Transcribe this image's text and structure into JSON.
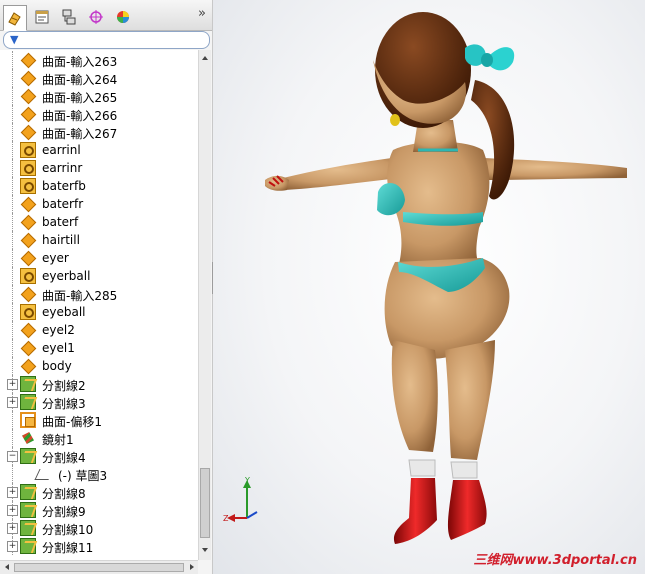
{
  "tabs": [
    {
      "name": "feature-manager",
      "icon": "feature-tree-icon",
      "active": true
    },
    {
      "name": "property-manager",
      "icon": "property-sheet-icon",
      "active": false
    },
    {
      "name": "configuration-manager",
      "icon": "configuration-icon",
      "active": false
    },
    {
      "name": "dimxpert-manager",
      "icon": "crosshair-icon",
      "active": false
    },
    {
      "name": "display-manager",
      "icon": "color-wheel-icon",
      "active": false
    }
  ],
  "more_glyph": "»",
  "tree": {
    "items": [
      {
        "label": "曲面-輸入263",
        "icon": "surface",
        "expander": ""
      },
      {
        "label": "曲面-輸入264",
        "icon": "surface",
        "expander": ""
      },
      {
        "label": "曲面-輸入265",
        "icon": "surface",
        "expander": ""
      },
      {
        "label": "曲面-輸入266",
        "icon": "surface",
        "expander": ""
      },
      {
        "label": "曲面-輸入267",
        "icon": "surface",
        "expander": ""
      },
      {
        "label": "earrinl",
        "icon": "part",
        "expander": ""
      },
      {
        "label": "earrinr",
        "icon": "part",
        "expander": ""
      },
      {
        "label": "baterfb",
        "icon": "part",
        "expander": ""
      },
      {
        "label": "baterfr",
        "icon": "surface",
        "expander": ""
      },
      {
        "label": "baterf",
        "icon": "surface",
        "expander": ""
      },
      {
        "label": "hairtill",
        "icon": "surface",
        "expander": ""
      },
      {
        "label": "eyer",
        "icon": "surface",
        "expander": ""
      },
      {
        "label": "eyerball",
        "icon": "part",
        "expander": ""
      },
      {
        "label": "曲面-輸入285",
        "icon": "surface",
        "expander": ""
      },
      {
        "label": "eyeball",
        "icon": "part",
        "expander": ""
      },
      {
        "label": "eyel2",
        "icon": "surface",
        "expander": ""
      },
      {
        "label": "eyel1",
        "icon": "surface",
        "expander": ""
      },
      {
        "label": "body",
        "icon": "surface",
        "expander": ""
      },
      {
        "label": "分割線2",
        "icon": "split",
        "expander": "+"
      },
      {
        "label": "分割線3",
        "icon": "split",
        "expander": "+"
      },
      {
        "label": "曲面-偏移1",
        "icon": "offset",
        "expander": ""
      },
      {
        "label": "鏡射1",
        "icon": "mirror",
        "expander": ""
      },
      {
        "label": "分割線4",
        "icon": "split",
        "expander": "-"
      },
      {
        "label": "(-) 草圖3",
        "icon": "sketch",
        "expander": "",
        "child": true
      },
      {
        "label": "分割線8",
        "icon": "split",
        "expander": "+"
      },
      {
        "label": "分割線9",
        "icon": "split",
        "expander": "+"
      },
      {
        "label": "分割線10",
        "icon": "split",
        "expander": "+"
      },
      {
        "label": "分割線11",
        "icon": "split",
        "expander": "+"
      }
    ]
  },
  "triad": {
    "x_label": "X",
    "y_label": "Y",
    "z_label": "Z"
  },
  "watermark": "三维网www.3dportal.cn",
  "colors": {
    "skin": "#c99a6a",
    "hair": "#5a2a10",
    "bikini": "#2bb7b3",
    "boots": "#d01818",
    "bow": "#27c4c4"
  }
}
